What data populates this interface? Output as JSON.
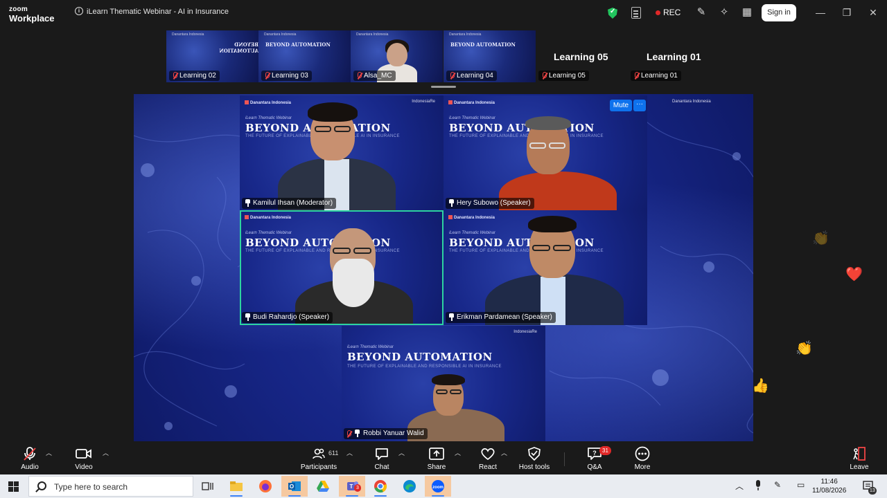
{
  "app": {
    "logo_line1": "zoom",
    "logo_line2": "Workplace",
    "window_title": "iLearn Thematic Webinar - AI in Insurance",
    "rec_label": "REC",
    "signin_label": "Sign in"
  },
  "filmstrip": [
    {
      "name": "Learning 02",
      "muted": true
    },
    {
      "name": "Learning 03",
      "muted": true
    },
    {
      "name": "Alsa_MC",
      "muted": true
    },
    {
      "name": "Learning 04",
      "muted": true
    },
    {
      "name": "Learning 05",
      "muted": true,
      "video_off": true
    },
    {
      "name": "Learning 01",
      "muted": true,
      "video_off": true
    }
  ],
  "background": {
    "brand": "Danantara Indonesia",
    "partner": "IndonesiaRe",
    "subtitle": "iLearn Thematic Webinar",
    "title": "BEYOND AUTOMATION",
    "tagline": "THE FUTURE OF EXPLAINABLE AND RESPONSIBLE AI IN INSURANCE"
  },
  "speakers": [
    {
      "name": "Kamilul Ihsan (Moderator)"
    },
    {
      "name": "Hery Subowo (Speaker)"
    },
    {
      "name": "Budi Rahardjo (Speaker)",
      "active": true
    },
    {
      "name": "Erikman Pardamean (Speaker)"
    },
    {
      "name": "Robbi Yanuar Walid",
      "muted": true
    }
  ],
  "hover_controls": {
    "mute_label": "Mute",
    "more_label": "···"
  },
  "toolbar": {
    "audio": "Audio",
    "video": "Video",
    "participants": "Participants",
    "participants_count": "611",
    "chat": "Chat",
    "share": "Share",
    "react": "React",
    "host_tools": "Host tools",
    "qa": "Q&A",
    "qa_badge": "31",
    "more": "More",
    "leave": "Leave"
  },
  "taskbar": {
    "search_placeholder": "Type here to search",
    "teams_badge": "3",
    "time": "11:46",
    "date": "11/08/2026",
    "notif_count": "13"
  }
}
